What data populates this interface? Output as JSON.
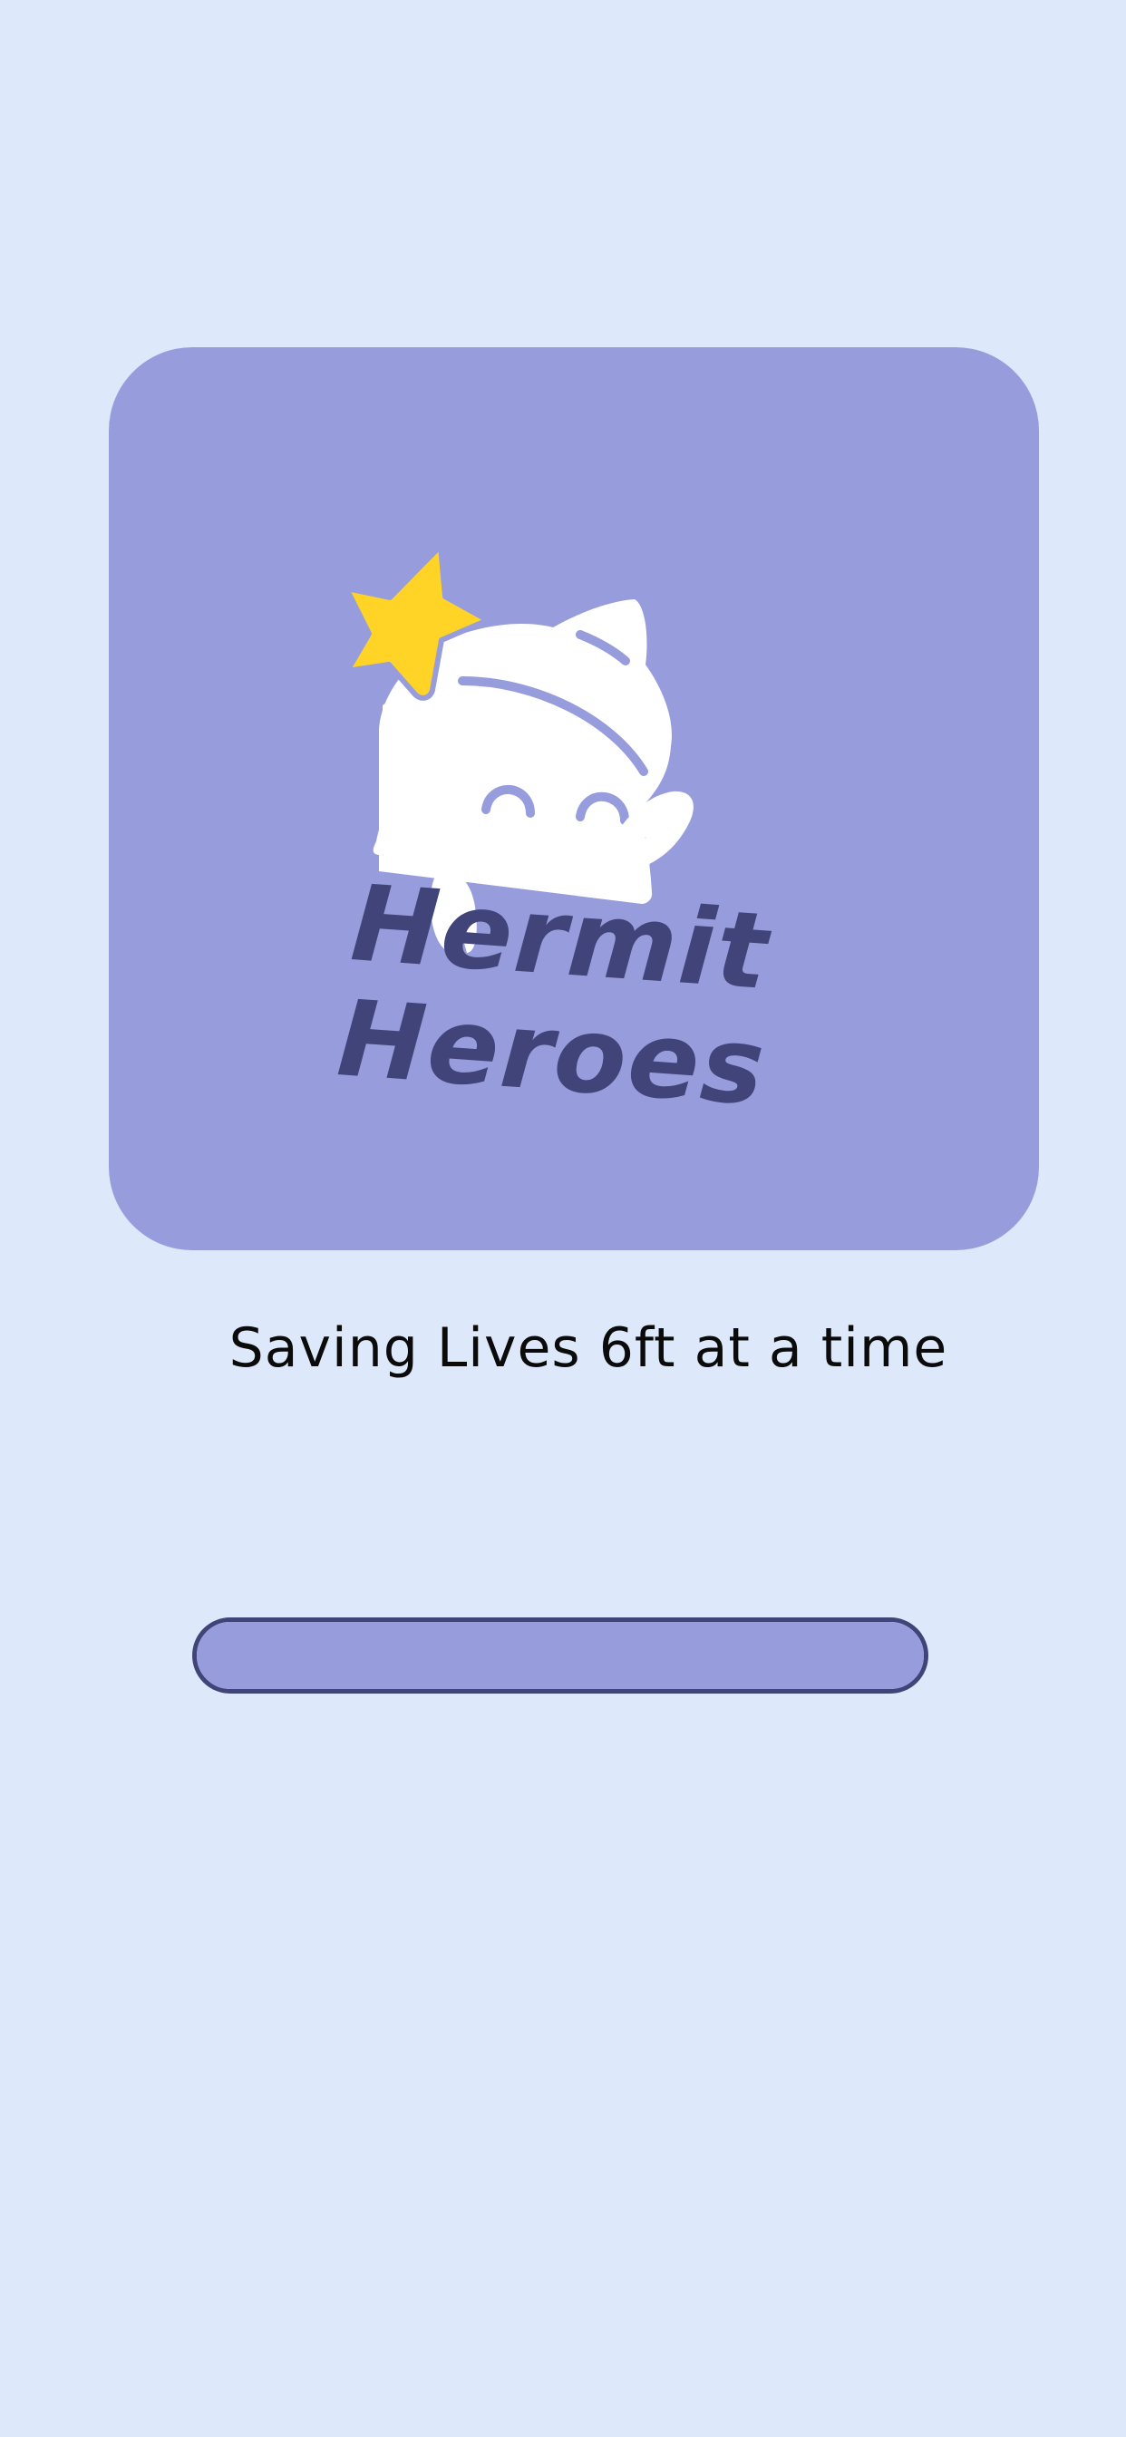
{
  "brand": {
    "line1": "Hermit",
    "line2": "Heroes"
  },
  "tagline": "Saving Lives 6ft at a time",
  "loading": {
    "progress_percent": 100
  },
  "colors": {
    "background": "#dde9fa",
    "card": "#979ddc",
    "brand_text": "#414479",
    "star": "#ffd426",
    "mascot": "#ffffff",
    "tagline_text": "#0b0b0b"
  },
  "icons": {
    "mascot": "hermit-crab-mascot-icon",
    "star": "star-icon"
  }
}
